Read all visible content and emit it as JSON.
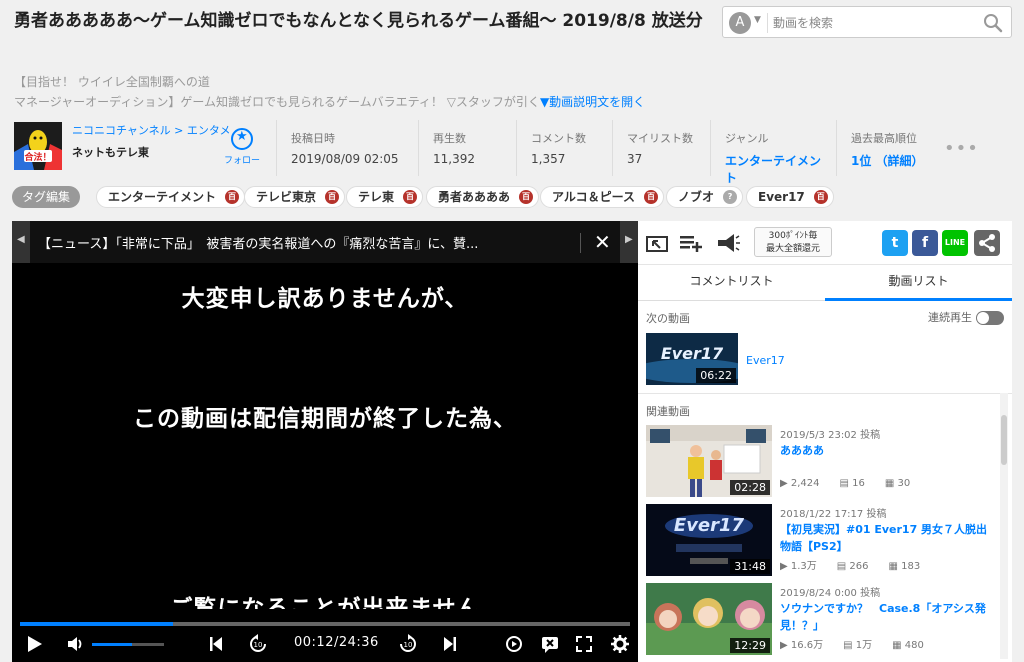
{
  "header": {
    "title": "勇者あああああ〜ゲーム知識ゼロでもなんとなく見られるゲーム番組〜 2019/8/8 放送分"
  },
  "search": {
    "placeholder": "動画を検索",
    "avatar_letter": "A"
  },
  "description": {
    "line1": "【目指せ！ ウイイレ全国制覇への道",
    "line2": "マネージャーオーディション】ゲーム知識ゼロでも見られるゲームバラエティ！ ▽スタッフが引く",
    "open_label": "▼動画説明文を開く"
  },
  "channel": {
    "breadcrumb": "ニコニコチャンネル > エンタメ",
    "name": "ネットもテレ東",
    "thumb_text": "合法！",
    "follow_label": "フォロー"
  },
  "stats": [
    {
      "label": "投稿日時",
      "value": "2019/08/09 02:05"
    },
    {
      "label": "再生数",
      "value": "11,392"
    },
    {
      "label": "コメント数",
      "value": "1,357"
    },
    {
      "label": "マイリスト数",
      "value": "37"
    },
    {
      "label": "ジャンル",
      "value": "エンターテイメント"
    },
    {
      "label": "過去最高順位",
      "value": "1位 （詳細）"
    }
  ],
  "more_dots": "•••",
  "tags": {
    "edit_label": "タグ編集",
    "items": [
      {
        "label": "エンターテイメント",
        "badge": "百"
      },
      {
        "label": "テレビ東京",
        "badge": "百"
      },
      {
        "label": "テレ東",
        "badge": "百"
      },
      {
        "label": "勇者ああああ",
        "badge": "百"
      },
      {
        "label": "アルコ＆ピース",
        "badge": "百"
      },
      {
        "label": "ノブオ",
        "badge": "?"
      },
      {
        "label": "Ever17",
        "badge": "百"
      }
    ]
  },
  "player": {
    "news_ticker": "【ニュース】「非常に下品」　被害者の実名報道への『痛烈な苦言』に、賛...",
    "message_lines": [
      "大変申し訳ありませんが、",
      "この動画は配信期間が終了した為、",
      "ご覧になることが出来ません"
    ],
    "time": "00:12/24:36",
    "progress": 0.25,
    "buffered": 1.0,
    "volume": 0.55
  },
  "sidepanel": {
    "promo_line1": "300ﾎﾟｲﾝﾄ毎",
    "promo_line2": "最大全額還元",
    "tabs": [
      "コメントリスト",
      "動画リスト"
    ],
    "active_tab": 1,
    "next_label": "次の動画",
    "autoplay_label": "連続再生",
    "next_video": {
      "title": "Ever17",
      "duration": "06:22",
      "thumb_text": "Ever17"
    },
    "related_label": "関連動画",
    "related": [
      {
        "date": "2019/5/3 23:02 投稿",
        "title": "ああああ",
        "duration": "02:28",
        "views": "2,424",
        "comments": "16",
        "mylists": "30"
      },
      {
        "date": "2018/1/22 17:17 投稿",
        "title": "【初見実況】#01 Ever17 男女７人脱出物語【PS2】",
        "duration": "31:48",
        "views": "1.3万",
        "comments": "266",
        "mylists": "183",
        "thumb_text": "Ever17"
      },
      {
        "date": "2019/8/24 0:00 投稿",
        "title": "ソウナンですか？　Case.8「オアシス発見！？」",
        "duration": "12:29",
        "views": "16.6万",
        "comments": "1万",
        "mylists": "480"
      }
    ]
  },
  "colors": {
    "accent": "#0080ff",
    "tag_badge": "#b5322b",
    "twitter": "#1da1f2",
    "facebook": "#3b5998",
    "line": "#00c300",
    "share": "#666666"
  }
}
